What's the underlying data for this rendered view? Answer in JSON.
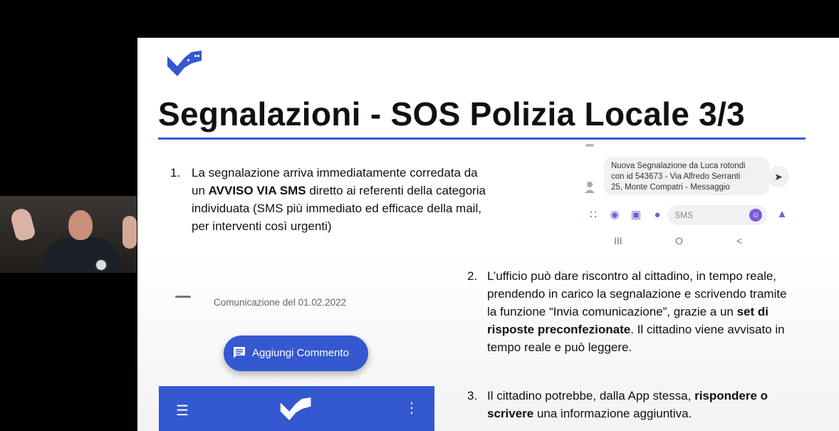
{
  "colors": {
    "accent": "#3458d0",
    "rule": "#3a5ad6",
    "sms_icons": "#7b5bd6"
  },
  "webcam": {
    "label": "presenter-webcam"
  },
  "slide": {
    "title": "Segnalazioni - SOS Polizia Locale 3/3",
    "items": [
      {
        "num": "1.",
        "lines": [
          {
            "parts": [
              "La segnalazione arriva immediatamente corredata da"
            ]
          },
          {
            "parts": [
              "un ",
              "AVVISO VIA SMS",
              " diretto ai referenti della categoria"
            ]
          },
          {
            "parts": [
              "individuata (SMS più immediato ed efficace della mail,"
            ]
          },
          {
            "parts": [
              "per interventi così urgenti)"
            ]
          }
        ]
      },
      {
        "num": "2.",
        "lines": [
          {
            "parts": [
              "L’ufficio può dare riscontro al cittadino, in tempo reale,"
            ]
          },
          {
            "parts": [
              "prendendo in carico la segnalazione e scrivendo tramite"
            ]
          },
          {
            "parts": [
              "la funzione “Invia comunicazione”, grazie a un ",
              "set di"
            ]
          },
          {
            "parts": [
              "risposte preconfezionate",
              ". Il cittadino viene avvisato in"
            ]
          },
          {
            "parts": [
              "tempo reale e può leggere."
            ]
          }
        ]
      },
      {
        "num": "3.",
        "lines": [
          {
            "parts": [
              "Il cittadino potrebbe, dalla App stessa, ",
              "rispondere o"
            ]
          },
          {
            "parts": [
              "scrivere",
              " una informazione aggiuntiva."
            ]
          }
        ]
      }
    ]
  },
  "sms_screenshot": {
    "message_lines": [
      "Nuova Segnalazione da Luca rotondi",
      "con id 543673 - Via Alfredo Serranti",
      "25, Monte Compatri - Messaggio"
    ],
    "input_placeholder": "SMS",
    "icons": [
      "apps-icon",
      "camera-icon",
      "gallery-icon",
      "mic-icon",
      "emoji-icon",
      "thumbs-up-icon",
      "share-icon"
    ],
    "nav": [
      "III",
      "O",
      "<"
    ]
  },
  "app_screenshot": {
    "communication_label": "Comunicazione del 01.02.2022",
    "fab_label": "Aggiungi Commento"
  }
}
